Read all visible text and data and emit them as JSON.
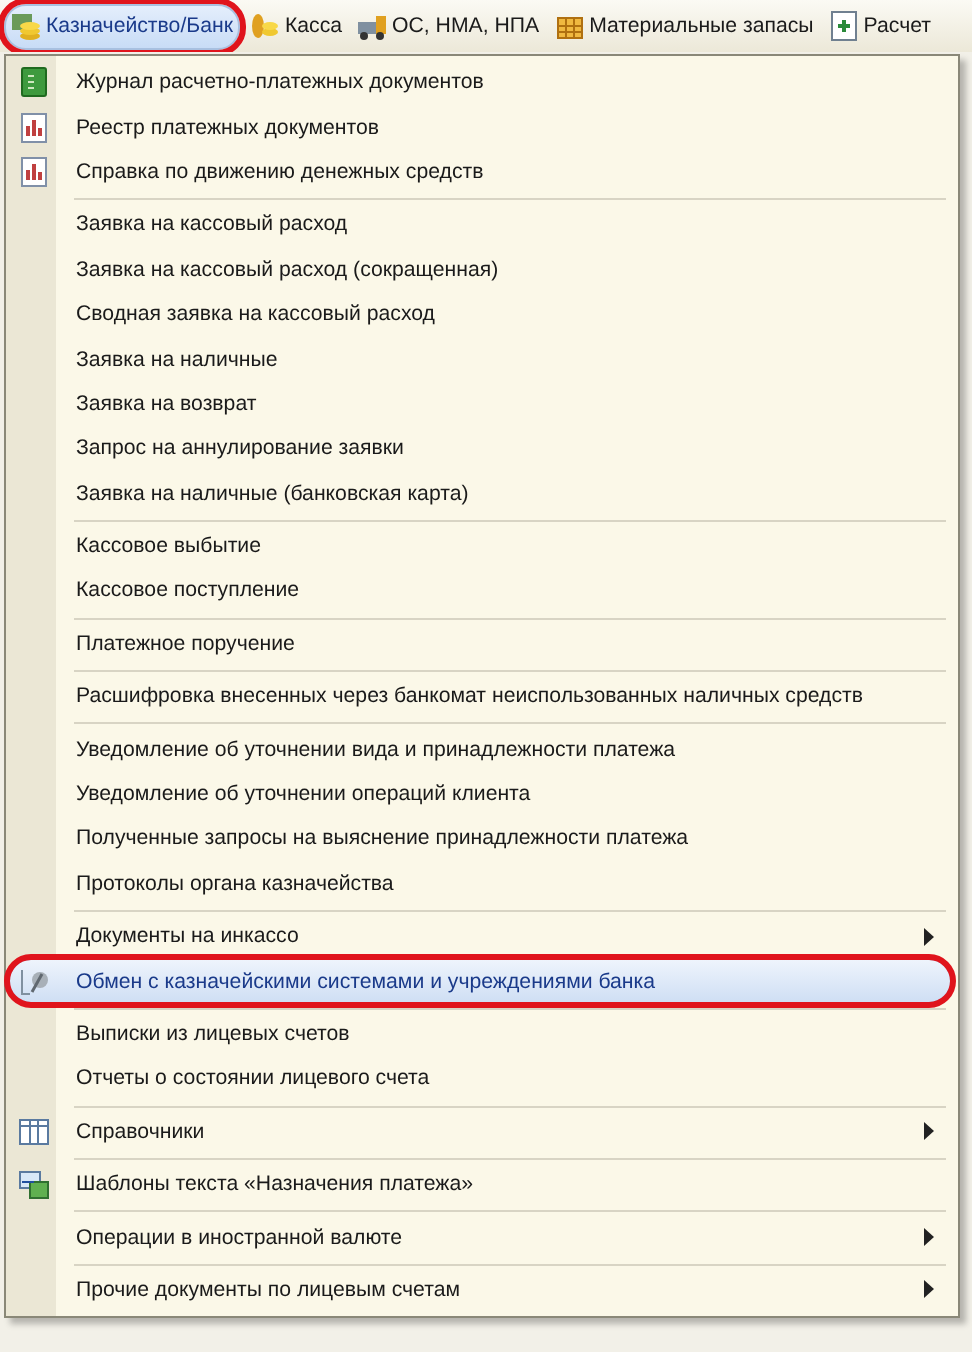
{
  "menu_bar": [
    {
      "label": "Казначейство/Банк",
      "selected": true,
      "circled": true
    },
    {
      "label": "Касса",
      "selected": false,
      "circled": false
    },
    {
      "label": "ОС, НМА, НПА",
      "selected": false,
      "circled": false
    },
    {
      "label": "Материальные запасы",
      "selected": false,
      "circled": false
    },
    {
      "label": "Расчет",
      "selected": false,
      "circled": false
    }
  ],
  "menu": {
    "groups": [
      [
        {
          "label": "Журнал  расчетно-платежных документов",
          "kind": "item",
          "selected": false,
          "circled": false
        },
        {
          "label": "Реестр платежных документов",
          "kind": "item",
          "selected": false,
          "circled": false
        },
        {
          "label": "Справка по движению денежных средств",
          "kind": "item",
          "selected": false,
          "circled": false
        }
      ],
      [
        {
          "label": "Заявка на кассовый расход",
          "kind": "item",
          "selected": false,
          "circled": false
        },
        {
          "label": "Заявка на кассовый расход (сокращенная)",
          "kind": "item",
          "selected": false,
          "circled": false
        },
        {
          "label": "Сводная заявка на кассовый расход",
          "kind": "item",
          "selected": false,
          "circled": false
        },
        {
          "label": "Заявка на наличные",
          "kind": "item",
          "selected": false,
          "circled": false
        },
        {
          "label": "Заявка на возврат",
          "kind": "item",
          "selected": false,
          "circled": false
        },
        {
          "label": "Запрос на аннулирование заявки",
          "kind": "item",
          "selected": false,
          "circled": false
        },
        {
          "label": "Заявка на наличные (банковская карта)",
          "kind": "item",
          "selected": false,
          "circled": false
        }
      ],
      [
        {
          "label": "Кассовое выбытие",
          "kind": "item",
          "selected": false,
          "circled": false
        },
        {
          "label": "Кассовое поступление",
          "kind": "item",
          "selected": false,
          "circled": false
        }
      ],
      [
        {
          "label": "Платежное поручение",
          "kind": "item",
          "selected": false,
          "circled": false
        }
      ],
      [
        {
          "label": "Расшифровка внесенных через банкомат неиспользованных наличных средств",
          "kind": "item",
          "selected": false,
          "circled": false
        }
      ],
      [
        {
          "label": "Уведомление об уточнении вида и принадлежности платежа",
          "kind": "item",
          "selected": false,
          "circled": false
        },
        {
          "label": "Уведомление об уточнении операций клиента",
          "kind": "item",
          "selected": false,
          "circled": false
        },
        {
          "label": "Полученные запросы на выяснение принадлежности платежа",
          "kind": "item",
          "selected": false,
          "circled": false
        },
        {
          "label": "Протоколы органа казначейства",
          "kind": "item",
          "selected": false,
          "circled": false
        }
      ],
      [
        {
          "label": "Документы на инкассо",
          "kind": "submenu",
          "selected": false,
          "circled": false
        },
        {
          "label": "Обмен с казначейскими системами и учреждениями банка",
          "kind": "item",
          "selected": true,
          "circled": true
        }
      ],
      [
        {
          "label": "Выписки из лицевых счетов",
          "kind": "item",
          "selected": false,
          "circled": false
        },
        {
          "label": "Отчеты о состоянии лицевого счета",
          "kind": "item",
          "selected": false,
          "circled": false
        }
      ],
      [
        {
          "label": "Справочники",
          "kind": "submenu",
          "selected": false,
          "circled": false
        }
      ],
      [
        {
          "label": "Шаблоны текста «Назначения платежа»",
          "kind": "item",
          "selected": false,
          "circled": false
        }
      ],
      [
        {
          "label": "Операции в иностранной валюте",
          "kind": "submenu",
          "selected": false,
          "circled": false
        }
      ],
      [
        {
          "label": "Прочие документы по лицевым счетам",
          "kind": "submenu",
          "selected": false,
          "circled": false
        }
      ]
    ]
  }
}
